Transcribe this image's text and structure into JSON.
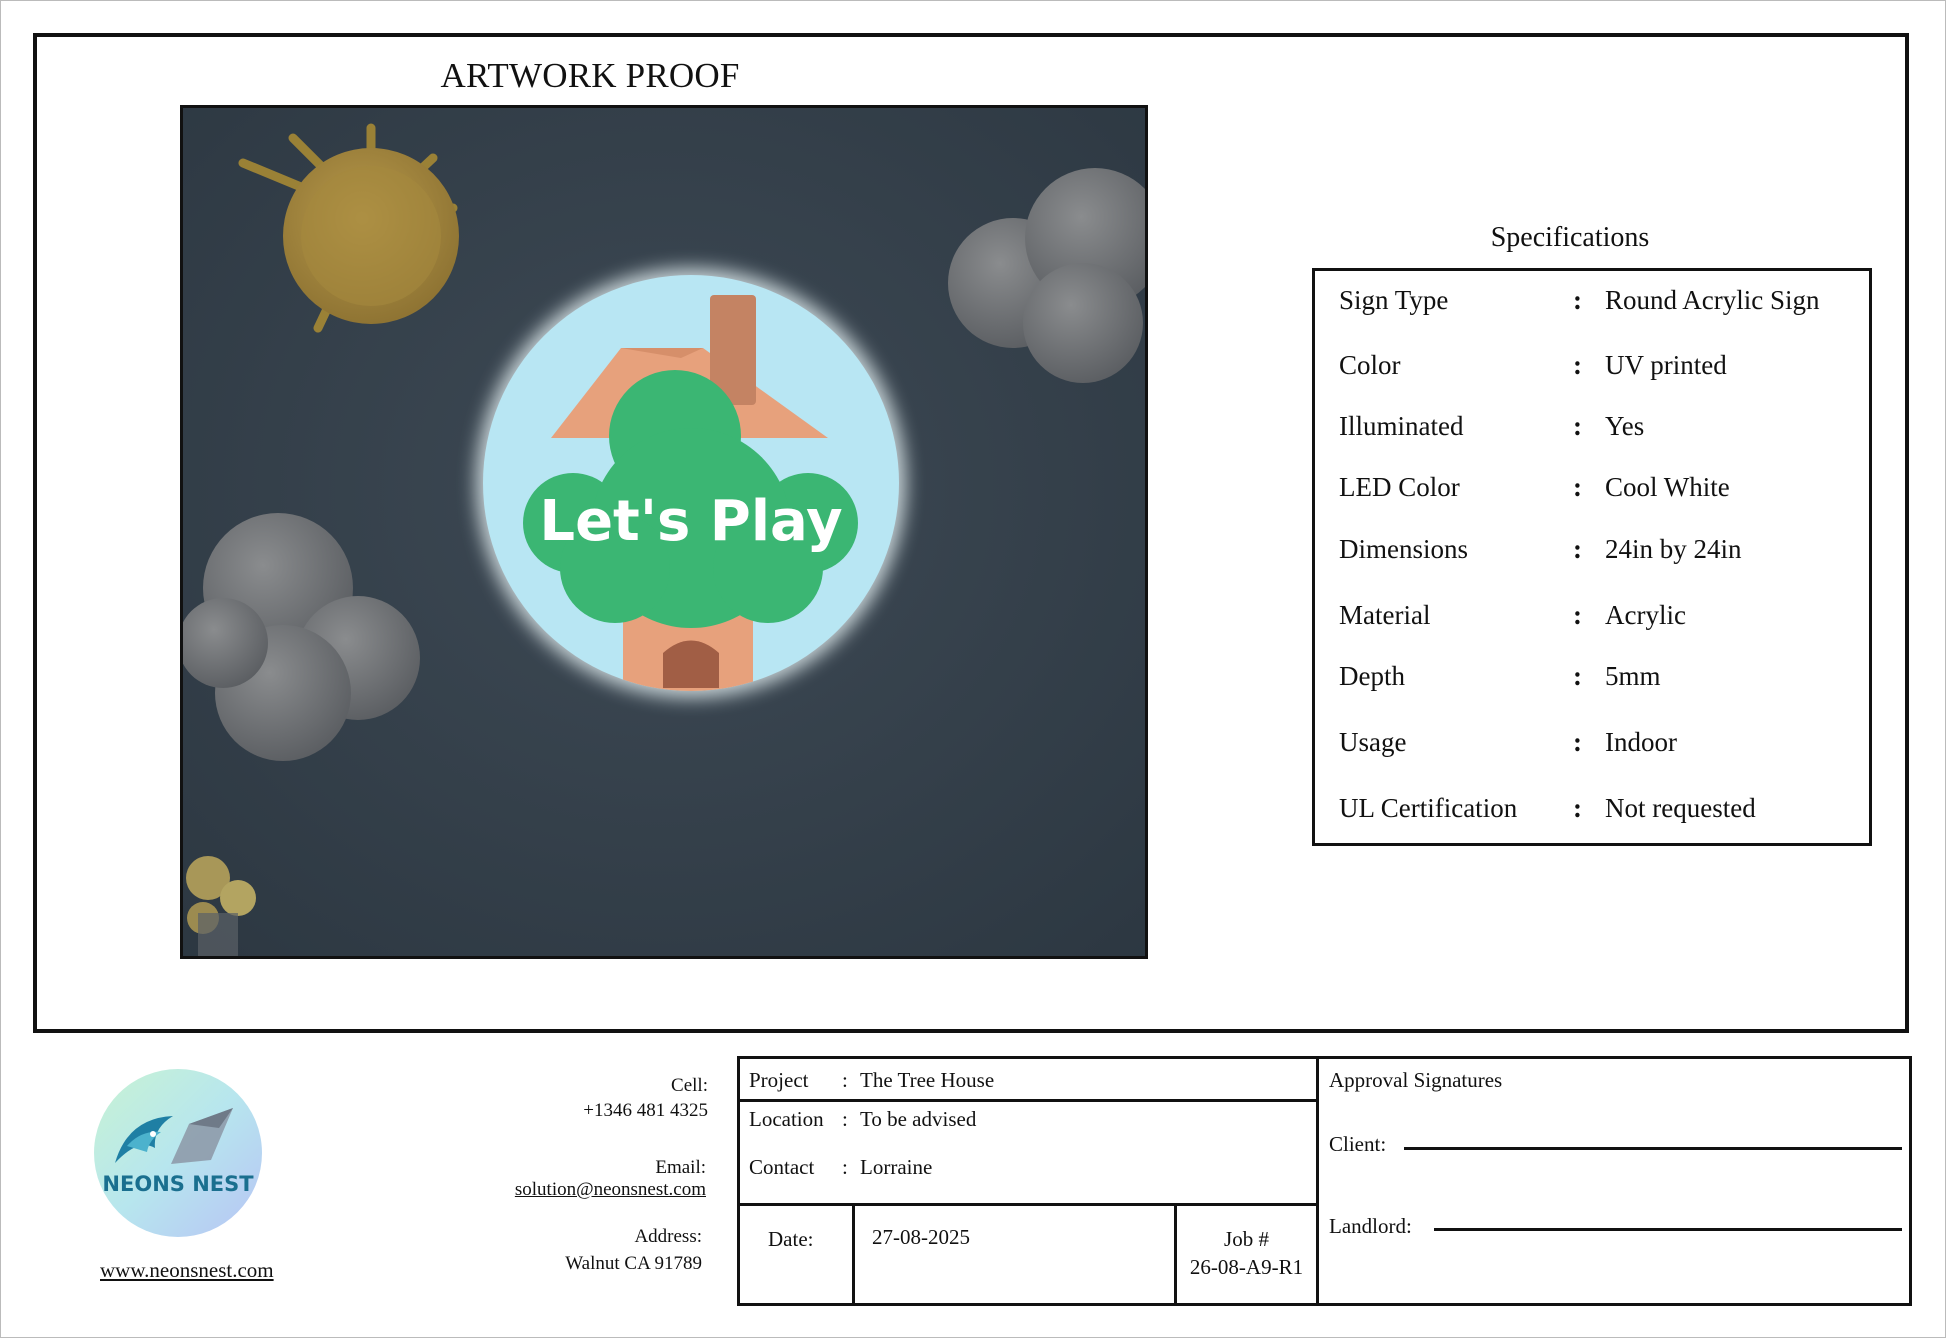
{
  "header": {
    "title": "ARTWORK PROOF"
  },
  "artwork": {
    "sign_text": "Let's Play"
  },
  "specifications": {
    "title": "Specifications",
    "rows": [
      {
        "label": "Sign Type",
        "value": "Round Acrylic Sign"
      },
      {
        "label": "Color",
        "value": "UV printed"
      },
      {
        "label": "Illuminated",
        "value": "Yes"
      },
      {
        "label": "LED Color",
        "value": "Cool White"
      },
      {
        "label": "Dimensions",
        "value": "24in by 24in"
      },
      {
        "label": "Material",
        "value": "Acrylic"
      },
      {
        "label": "Depth",
        "value": "5mm"
      },
      {
        "label": "Usage",
        "value": "Indoor"
      },
      {
        "label": "UL Certification",
        "value": "Not requested"
      }
    ]
  },
  "company": {
    "logo_text": "NEONS NEST",
    "website": "www.neonsnest.com",
    "cell_label": "Cell:",
    "cell": "+1346 481 4325",
    "email_label": "Email:",
    "email": "solution@neonsnest.com",
    "address_label": "Address:",
    "address": "Walnut CA 91789"
  },
  "project": {
    "project_label": "Project",
    "project": "The Tree House",
    "location_label": "Location",
    "location": "To be advised",
    "contact_label": "Contact",
    "contact": "Lorraine",
    "date_label": "Date:",
    "date": "27-08-2025",
    "job_label": "Job #",
    "job": "26-08-A9-R1"
  },
  "approval": {
    "title": "Approval Signatures",
    "client_label": "Client:",
    "landlord_label": "Landlord:"
  }
}
